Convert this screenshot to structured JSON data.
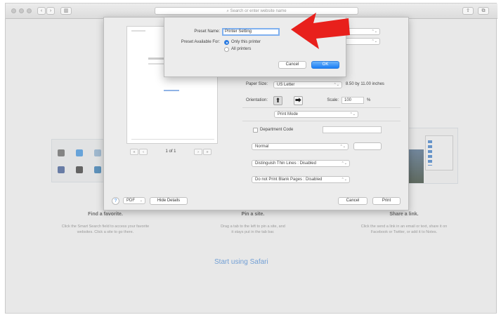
{
  "browser": {
    "address_placeholder": "Search or enter website name",
    "back_glyph": "‹",
    "forward_glyph": "›",
    "sidebar_glyph": "▥",
    "share_glyph": "⇧",
    "tabs_glyph": "⧉"
  },
  "start_page": {
    "features": [
      {
        "title": "Find a favorite.",
        "text_line1": "Click the Smart Search field to access your favorite",
        "text_line2": "websites. Click a site to go there."
      },
      {
        "title": "Pin a site.",
        "text_line1": "Drag a tab to the left to pin a site, and",
        "text_line2": "it stays put in the tab bar."
      },
      {
        "title": "Share a link.",
        "text_line1": "Click the send a link in an email or text, share it on",
        "text_line2": "Facebook or Twitter, or add it to Notes."
      }
    ],
    "start_link": "Start using Safari"
  },
  "preset_dialog": {
    "name_label": "Preset Name:",
    "name_value": "Printer Setting",
    "available_label": "Preset Available For:",
    "option_this": "Only this printer",
    "option_all": "All printers",
    "cancel": "Cancel",
    "ok": "OK"
  },
  "print_dialog": {
    "page_label": "1 of 1",
    "paper_size_label": "Paper Size:",
    "paper_size_value": "US Letter",
    "paper_size_dims": "8.50 by 11.00 inches",
    "orientation_label": "Orientation:",
    "scale_label": "Scale:",
    "scale_value": "100",
    "scale_unit": "%",
    "section_value": "Print Mode",
    "department_label": "Department Code",
    "mode_value": "Normal",
    "thin_lines_value": "Distinguish Thin Lines : Disabled",
    "blank_pages_value": "Do not Print Blank Pages : Disabled",
    "pdf_label": "PDF",
    "hide_details": "Hide Details",
    "help_glyph": "?",
    "cancel": "Cancel",
    "print": "Print"
  },
  "colors": {
    "accent": "#1b7ef5",
    "arrow": "#e8201c",
    "link": "#4a90e2"
  }
}
